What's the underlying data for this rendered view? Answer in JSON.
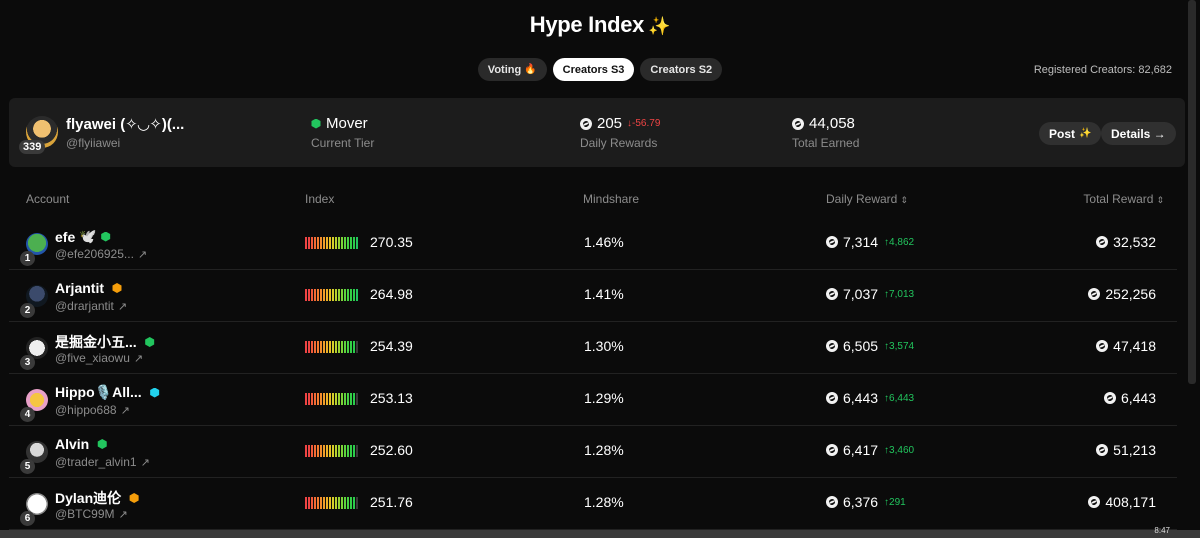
{
  "title": "Hype Index",
  "title_icon": "sparkle-icon",
  "tabs": [
    {
      "label": "Voting",
      "icon": "fire-icon"
    },
    {
      "label": "Creators S3",
      "active": true
    },
    {
      "label": "Creators S2"
    }
  ],
  "registered": "Registered Creators: 82,682",
  "me": {
    "name": "flyawei (✧◡✧)(...",
    "handle": "@flyiiawei",
    "rank": "339",
    "tier": "Mover",
    "tier_label": "Current Tier",
    "daily": "205",
    "daily_change": "↓-56.79",
    "daily_label": "Daily Rewards",
    "total": "44,058",
    "total_label": "Total Earned",
    "post_label": "Post",
    "details_label": "Details →"
  },
  "headers": {
    "account": "Account",
    "index": "Index",
    "mindshare": "Mindshare",
    "daily": "Daily Reward",
    "total": "Total Reward"
  },
  "rows": [
    {
      "rank": "1",
      "name": "efe",
      "emoji": "🕊️",
      "badge_color": "#22c55e",
      "handle": "@efe206925...",
      "index": "270.35",
      "bar_fill": 1.0,
      "mindshare": "1.46%",
      "daily": "7,314",
      "daily_change": "↑4,862",
      "total": "32,532"
    },
    {
      "rank": "2",
      "name": "Arjantit",
      "emoji": "",
      "badge_color": "#f59e0b",
      "handle": "@drarjantit",
      "index": "264.98",
      "bar_fill": 0.98,
      "mindshare": "1.41%",
      "daily": "7,037",
      "daily_change": "↑7,013",
      "total": "252,256"
    },
    {
      "rank": "3",
      "name": "是掘金小五...",
      "emoji": "",
      "badge_color": "#22c55e",
      "handle": "@five_xiaowu",
      "index": "254.39",
      "bar_fill": 0.95,
      "mindshare": "1.30%",
      "daily": "6,505",
      "daily_change": "↑3,574",
      "total": "47,418"
    },
    {
      "rank": "4",
      "name": "Hippo🎙️All...",
      "emoji": "",
      "badge_color": "#22d3ee",
      "handle": "@hippo688",
      "index": "253.13",
      "bar_fill": 0.94,
      "mindshare": "1.29%",
      "daily": "6,443",
      "daily_change": "↑6,443",
      "total": "6,443"
    },
    {
      "rank": "5",
      "name": "Alvin",
      "emoji": "",
      "badge_color": "#22c55e",
      "handle": "@trader_alvin1",
      "index": "252.60",
      "bar_fill": 0.94,
      "mindshare": "1.28%",
      "daily": "6,417",
      "daily_change": "↑3,460",
      "total": "51,213"
    },
    {
      "rank": "6",
      "name": "Dylan迪伦",
      "emoji": "",
      "badge_color": "#f59e0b",
      "handle": "@BTC99M",
      "index": "251.76",
      "bar_fill": 0.93,
      "mindshare": "1.28%",
      "daily": "6,376",
      "daily_change": "↑291",
      "total": "408,171"
    }
  ],
  "clock": "8:47"
}
